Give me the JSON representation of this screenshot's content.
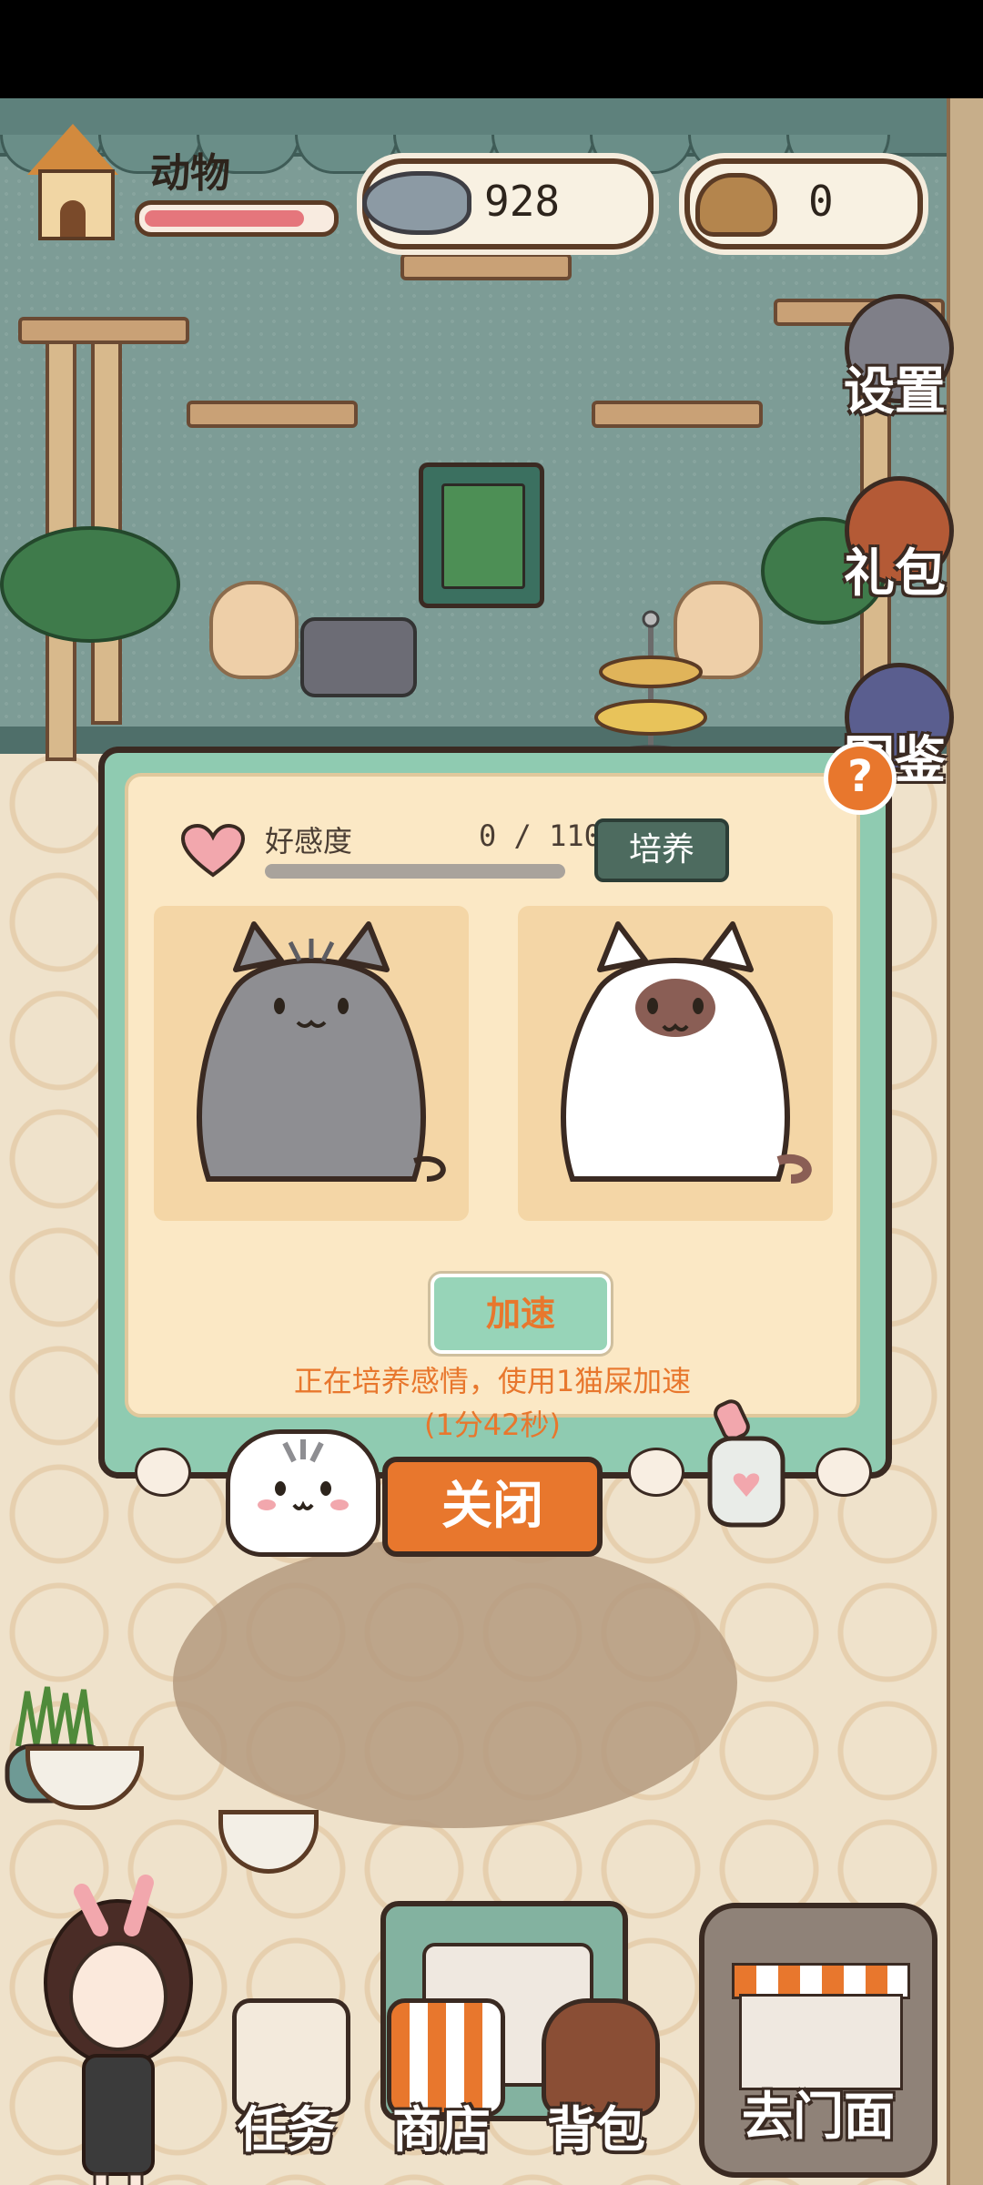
{
  "hud": {
    "name": "动物",
    "health_level": 0.92,
    "fish_value": "928",
    "poop_value": "0"
  },
  "side_menu": [
    {
      "label": "设置",
      "icon": "gear-icon",
      "color": "#7f7f88"
    },
    {
      "label": "礼包",
      "icon": "gift-bag-icon",
      "color": "#b45a36"
    },
    {
      "label": "图鉴",
      "icon": "book-icon",
      "color": "#5a5e8f"
    }
  ],
  "popup": {
    "affection_label": "好感度",
    "affection_current": "0",
    "affection_max": "110",
    "affection_count": "0 / 110",
    "affection_level": 0,
    "train_label": "培养",
    "speedup_label": "加速",
    "hint_line1": "正在培养感情，使用1猫屎加速",
    "hint_line2": "(1分42秒)",
    "help_label": "?",
    "cat_left_color": "#8e8e92",
    "cat_right_color": "#ffffff"
  },
  "close_label": "关闭",
  "bottom_nav": [
    {
      "label": "任务",
      "icon": "task-scroll-icon"
    },
    {
      "label": "商店",
      "icon": "shop-awning-icon"
    },
    {
      "label": "背包",
      "icon": "backpack-icon"
    }
  ],
  "store_button": {
    "label": "去门面",
    "icon": "storefront-icon"
  },
  "colors": {
    "accent_orange": "#e8772d",
    "panel_green": "#8fcbb1",
    "panel_cream": "#fbe8c5",
    "wall": "#7d9c96"
  }
}
